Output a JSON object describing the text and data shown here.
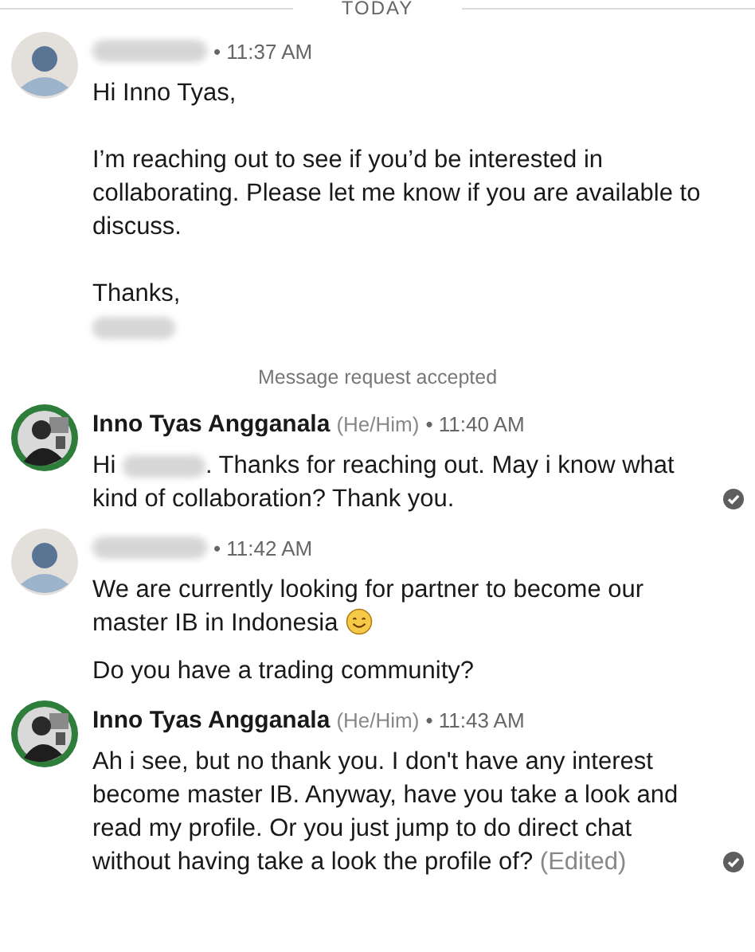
{
  "date_divider": "TODAY",
  "items": [
    {
      "kind": "message",
      "sender_redacted": true,
      "time": "• 11:37 AM",
      "bodies": [
        {
          "seen": false,
          "paragraphs": [
            [
              {
                "kind": "text",
                "text": "Hi Inno Tyas,"
              }
            ],
            [
              {
                "kind": "text",
                "text": "I’m reaching out to see if you’d be interested in collaborating. Please let me know if you are available to discuss."
              }
            ],
            [
              {
                "kind": "text",
                "text": "Thanks,"
              },
              {
                "kind": "break"
              },
              {
                "kind": "redacted"
              }
            ]
          ]
        }
      ]
    },
    {
      "kind": "notice",
      "text": "Message request accepted"
    },
    {
      "kind": "message",
      "sender_redacted": false,
      "sender": "Inno Tyas Angganala",
      "pronouns": "(He/Him)",
      "time": "• 11:40 AM",
      "bodies": [
        {
          "seen": true,
          "paragraphs": [
            [
              {
                "kind": "text",
                "text": "Hi "
              },
              {
                "kind": "redacted"
              },
              {
                "kind": "text",
                "text": ". Thanks for reaching out. May i know what kind of collaboration? Thank you."
              }
            ]
          ]
        }
      ]
    },
    {
      "kind": "message",
      "sender_redacted": true,
      "time": "• 11:42 AM",
      "bodies": [
        {
          "seen": false,
          "paragraphs": [
            [
              {
                "kind": "text",
                "text": "We are currently looking for partner to become our master IB in Indonesia "
              },
              {
                "kind": "emoji"
              }
            ]
          ]
        },
        {
          "seen": false,
          "paragraphs": [
            [
              {
                "kind": "text",
                "text": "Do you have a trading community?"
              }
            ]
          ]
        }
      ]
    },
    {
      "kind": "message",
      "sender_redacted": false,
      "sender": "Inno Tyas Angganala",
      "pronouns": "(He/Him)",
      "time": "• 11:43 AM",
      "bodies": [
        {
          "seen": true,
          "paragraphs": [
            [
              {
                "kind": "text",
                "text": "Ah i see, but no thank you. I don't have any interest become master IB. Anyway, have you take a look and read my profile. Or you just jump to do direct chat without having take a look the profile of? "
              },
              {
                "kind": "edited",
                "text": "(Edited)"
              }
            ]
          ]
        }
      ]
    }
  ]
}
